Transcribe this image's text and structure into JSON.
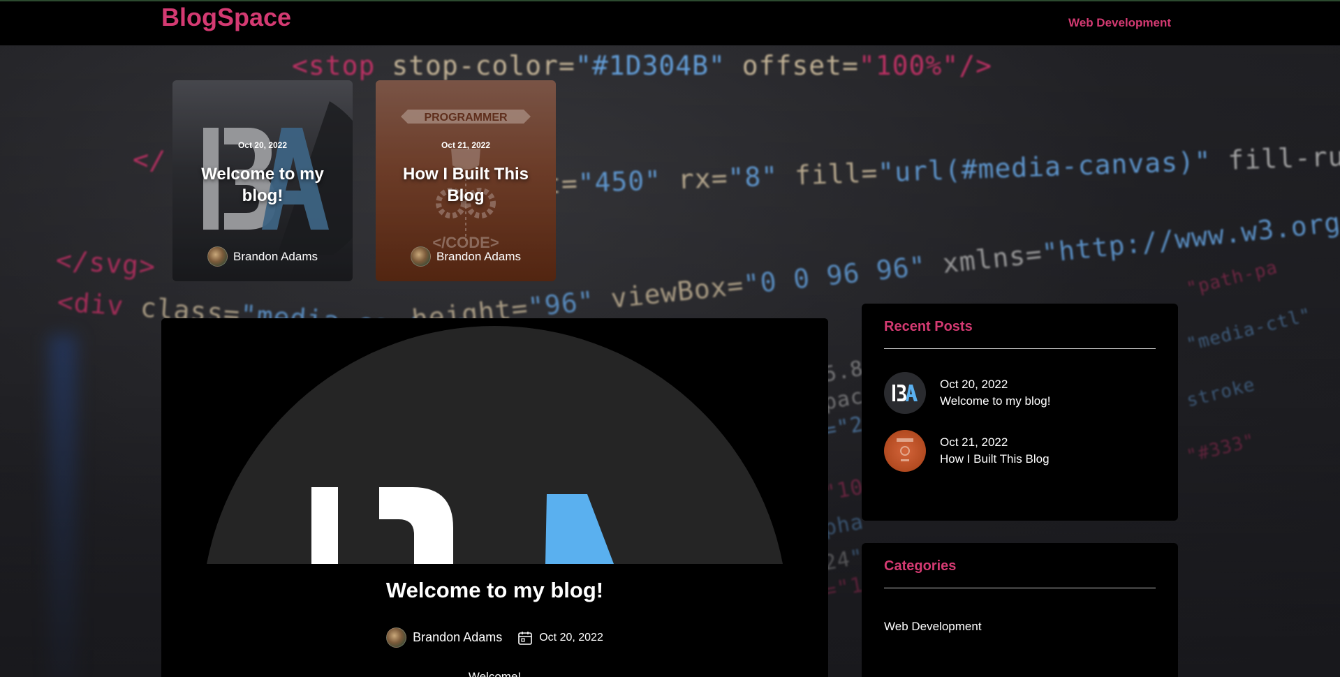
{
  "header": {
    "logo": "BlogSpace",
    "nav_link": "Web Development"
  },
  "featured_cards": [
    {
      "date": "Oct 20, 2022",
      "title": "Welcome to my blog!",
      "author": "Brandon Adams",
      "image_label": "BA"
    },
    {
      "date": "Oct 21, 2022",
      "title": "How I Built This Blog",
      "author": "Brandon Adams",
      "badge": "PROGRAMMER",
      "caption": "</CODE>"
    }
  ],
  "post": {
    "title": "Welcome to my blog!",
    "author": "Brandon Adams",
    "date": "Oct 20, 2022",
    "excerpt": "Welcome!"
  },
  "sidebar": {
    "recent_posts": {
      "title": "Recent Posts",
      "items": [
        {
          "date": "Oct 20, 2022",
          "title": "Welcome to my blog!",
          "thumb_label": "BA"
        },
        {
          "date": "Oct 21, 2022",
          "title": "How I Built This Blog"
        }
      ]
    },
    "categories": {
      "title": "Categories",
      "items": [
        "Web Development"
      ]
    }
  },
  "colors": {
    "accent": "#d43a72",
    "logo_blue": "#5ab0ef"
  },
  "icons": {
    "calendar": "calendar-icon"
  }
}
